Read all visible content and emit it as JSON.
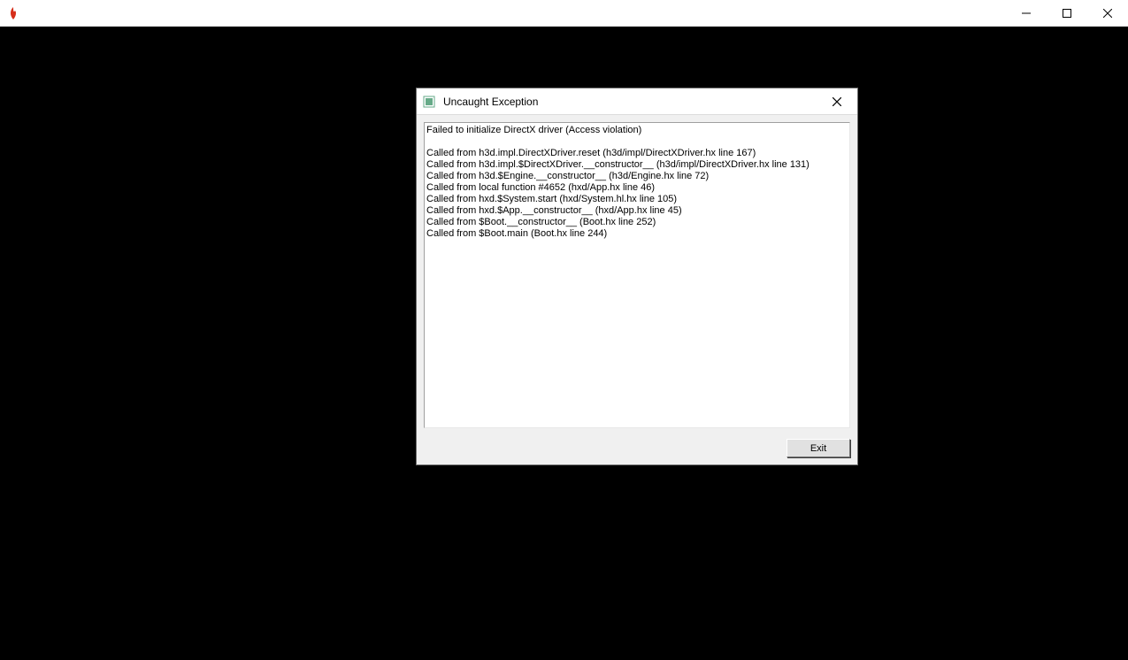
{
  "dialog": {
    "title": "Uncaught Exception",
    "body_lines": [
      "Failed to initialize DirectX driver (Access violation)",
      "",
      "Called from h3d.impl.DirectXDriver.reset (h3d/impl/DirectXDriver.hx line 167)",
      "Called from h3d.impl.$DirectXDriver.__constructor__ (h3d/impl/DirectXDriver.hx line 131)",
      "Called from h3d.$Engine.__constructor__ (h3d/Engine.hx line 72)",
      "Called from local function #4652 (hxd/App.hx line 46)",
      "Called from hxd.$System.start (hxd/System.hl.hx line 105)",
      "Called from hxd.$App.__constructor__ (hxd/App.hx line 45)",
      "Called from $Boot.__constructor__ (Boot.hx line 252)",
      "Called from $Boot.main (Boot.hx line 244)"
    ],
    "exit_label": "Exit"
  }
}
